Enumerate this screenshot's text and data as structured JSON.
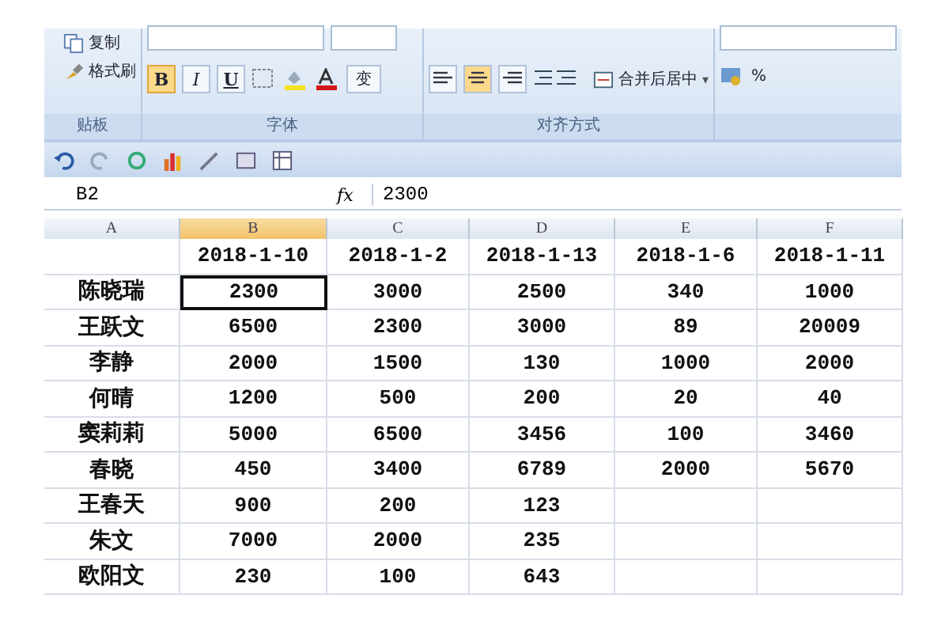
{
  "ribbon": {
    "clipboard": {
      "items": [
        "复制",
        "格式刷"
      ],
      "label": "贴板"
    },
    "font": {
      "buttons": [
        {
          "text": "B",
          "selected": true
        },
        {
          "text": "I",
          "selected": false
        },
        {
          "text": "U",
          "selected": false
        }
      ],
      "phonetic": "变",
      "label": "字体"
    },
    "alignment": {
      "aligns": [
        {
          "kind": "left",
          "selected": false
        },
        {
          "kind": "center",
          "selected": true
        },
        {
          "kind": "right",
          "selected": false
        }
      ],
      "merge": "合并后居中",
      "merge_caret": "▾",
      "label": "对齐方式"
    },
    "number": {
      "percent": "%"
    }
  },
  "formula_bar": {
    "name_box": "B2",
    "fx": "fx",
    "value": "2300"
  },
  "columns": [
    {
      "label": "A",
      "selected": false
    },
    {
      "label": "B",
      "selected": true
    },
    {
      "label": "C",
      "selected": false
    },
    {
      "label": "D",
      "selected": false
    },
    {
      "label": "E",
      "selected": false
    },
    {
      "label": "F",
      "selected": false
    }
  ],
  "header_row": [
    "2018-1-10",
    "2018-1-2",
    "2018-1-13",
    "2018-1-6",
    "2018-1-11"
  ],
  "rows": [
    {
      "name": "陈晓瑞",
      "values": [
        {
          "text": "2300",
          "selected": true
        },
        {
          "text": "3000",
          "selected": false
        },
        {
          "text": "2500",
          "selected": false
        },
        {
          "text": "340",
          "selected": false
        },
        {
          "text": "1000",
          "selected": false
        }
      ]
    },
    {
      "name": "王跃文",
      "values": [
        {
          "text": "6500",
          "selected": false
        },
        {
          "text": "2300",
          "selected": false
        },
        {
          "text": "3000",
          "selected": false
        },
        {
          "text": "89",
          "selected": false
        },
        {
          "text": "20009",
          "selected": false
        }
      ]
    },
    {
      "name": "李静",
      "values": [
        {
          "text": "2000",
          "selected": false
        },
        {
          "text": "1500",
          "selected": false
        },
        {
          "text": "130",
          "selected": false
        },
        {
          "text": "1000",
          "selected": false
        },
        {
          "text": "2000",
          "selected": false
        }
      ]
    },
    {
      "name": "何晴",
      "values": [
        {
          "text": "1200",
          "selected": false
        },
        {
          "text": "500",
          "selected": false
        },
        {
          "text": "200",
          "selected": false
        },
        {
          "text": "20",
          "selected": false
        },
        {
          "text": "40",
          "selected": false
        }
      ]
    },
    {
      "name": "窦莉莉",
      "values": [
        {
          "text": "5000",
          "selected": false
        },
        {
          "text": "6500",
          "selected": false
        },
        {
          "text": "3456",
          "selected": false
        },
        {
          "text": "100",
          "selected": false
        },
        {
          "text": "3460",
          "selected": false
        }
      ]
    },
    {
      "name": "春晓",
      "values": [
        {
          "text": "450",
          "selected": false
        },
        {
          "text": "3400",
          "selected": false
        },
        {
          "text": "6789",
          "selected": false
        },
        {
          "text": "2000",
          "selected": false
        },
        {
          "text": "5670",
          "selected": false
        }
      ]
    },
    {
      "name": "王春天",
      "values": [
        {
          "text": "900",
          "selected": false
        },
        {
          "text": "200",
          "selected": false
        },
        {
          "text": "123",
          "selected": false
        }
      ]
    },
    {
      "name": "朱文",
      "values": [
        {
          "text": "7000",
          "selected": false
        },
        {
          "text": "2000",
          "selected": false
        },
        {
          "text": "235",
          "selected": false
        }
      ]
    },
    {
      "name": "欧阳文",
      "values": [
        {
          "text": "230",
          "selected": false
        },
        {
          "text": "100",
          "selected": false
        },
        {
          "text": "643",
          "selected": false
        }
      ]
    }
  ]
}
